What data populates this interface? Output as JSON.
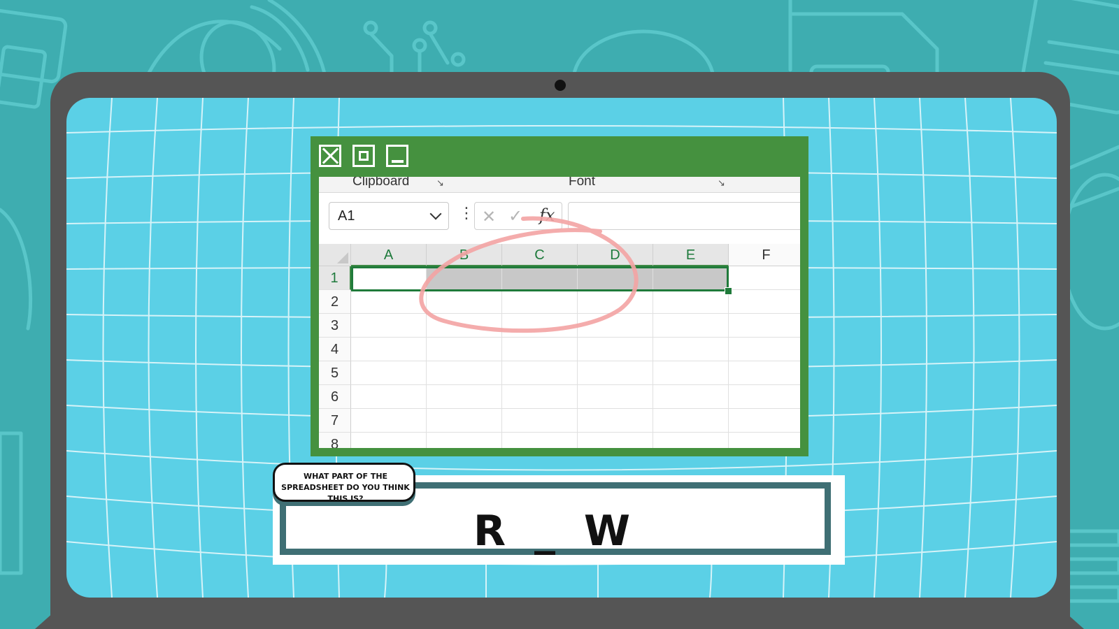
{
  "colors": {
    "background": "#3eadb0",
    "laptop": "#555555",
    "screen": "#5bd0e6",
    "window_frame": "#45913f",
    "selection": "#1f7a3a",
    "highlight_circle": "#f3a3a3",
    "answer_border": "#3f6f74"
  },
  "window": {
    "controls": [
      "close-icon",
      "maximize-icon",
      "minimize-icon"
    ]
  },
  "ribbon": {
    "clipboard_label": "Clipboard",
    "font_label": "Font",
    "launcher_icon": "dialog-launcher-icon"
  },
  "formula_bar": {
    "name_box_value": "A1",
    "options_glyph": "⋮",
    "cancel_glyph": "✕",
    "enter_glyph": "✓",
    "fx_label": "fx",
    "formula_value": ""
  },
  "sheet": {
    "columns": [
      "A",
      "B",
      "C",
      "D",
      "E",
      "F"
    ],
    "rows": [
      "1",
      "2",
      "3",
      "4",
      "5",
      "6",
      "7",
      "8"
    ],
    "active_cell": "A1",
    "selected_range": "A1:E1"
  },
  "prompt": {
    "question": "What part of the spreadsheet do you think this is?",
    "answer_hint": "R _ W"
  }
}
